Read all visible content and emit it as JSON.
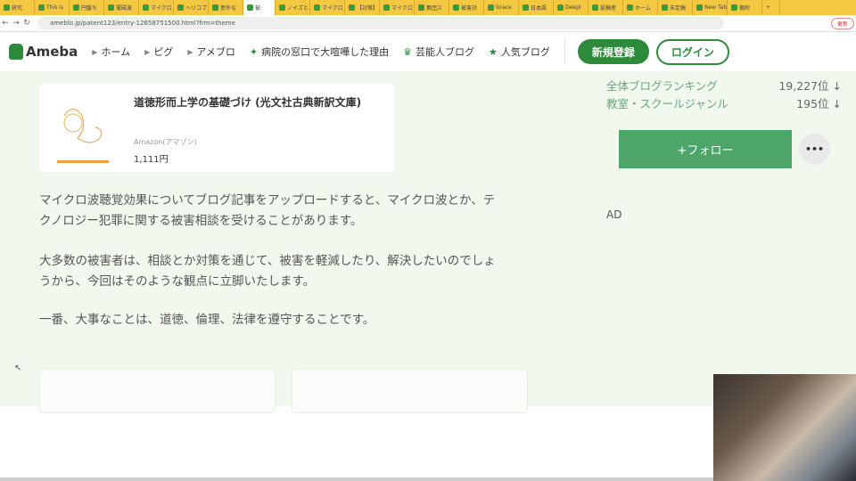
{
  "browser": {
    "tabs": [
      "研究",
      "This is",
      "円盤ち",
      "電磁波",
      "マイクロ",
      "ヘリコプ",
      "意外な",
      "被:",
      "ノイズと",
      "マイクロ",
      "【対策】",
      "マイクロ",
      "集団ス",
      "被害対",
      "Grace",
      "日本語",
      "Deepl",
      "投稿者",
      "ホーム",
      "未定稿",
      "New Tab",
      "傷附"
    ],
    "active_tab_index": 7,
    "url": "ameblo.jp/patent123/entry-12658751500.html?frm=theme",
    "update_label": "更新"
  },
  "header": {
    "logo": "Ameba",
    "nav": [
      {
        "label": "ホーム",
        "icon": "triangle-icon"
      },
      {
        "label": "ピグ",
        "icon": "triangle-icon"
      },
      {
        "label": "アメブロ",
        "icon": "triangle-icon"
      },
      {
        "label": "病院の窓口で大喧嘩した理由",
        "icon": "sparkle-icon"
      },
      {
        "label": "芸能人ブログ",
        "icon": "crown-icon"
      },
      {
        "label": "人気ブログ",
        "icon": "star-icon"
      }
    ],
    "register": "新規登録",
    "login": "ログイン"
  },
  "book": {
    "title": "道徳形而上学の基礎づけ (光文社古典新訳文庫)",
    "shop": "Amazon(アマゾン)",
    "price": "1,111円"
  },
  "paragraphs": [
    [
      "マイクロ波聴覚効果についてブログ記事をアップロードすると、マイクロ波とか、テ",
      "クノロジー犯罪に関する被害相談を受けることがあります。"
    ],
    [
      "大多数の被害者は、相談とか対策を通じて、被害を軽減したり、解決したいのでしょ",
      "うから、今回はそのような観点に立脚いたします。"
    ],
    [
      "一番、大事なことは、道徳、倫理、法律を遵守することです。"
    ]
  ],
  "sidebar": {
    "rankings": [
      {
        "label": "全体ブログランキング",
        "value": "19,227位 ↓"
      },
      {
        "label": "教室・スクールジャンル",
        "value": "195位 ↓"
      }
    ],
    "follow": "+フォロー",
    "more": "•••",
    "ad": "AD"
  }
}
